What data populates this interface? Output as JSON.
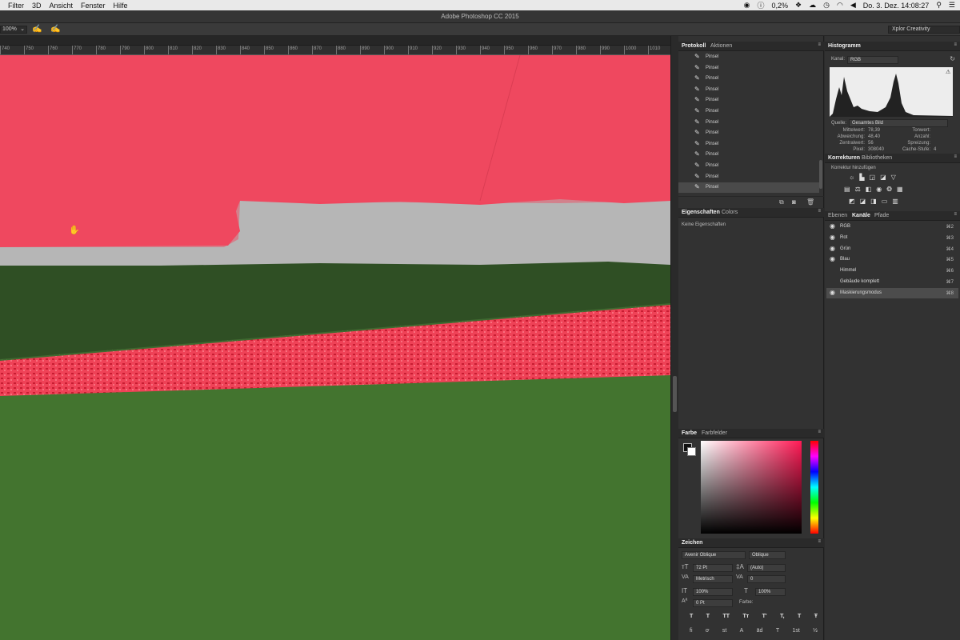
{
  "menubar": {
    "items": [
      "Filter",
      "3D",
      "Ansicht",
      "Fenster",
      "Hilfe"
    ],
    "battery": "0,2%",
    "datetime": "Do. 3. Dez.  14:08:27"
  },
  "window": {
    "title": "Adobe Photoshop CC 2015"
  },
  "options": {
    "zoom": "100%",
    "workspace": "Xplor Creativity"
  },
  "ruler": {
    "ticks": [
      "740",
      "750",
      "760",
      "770",
      "780",
      "790",
      "800",
      "810",
      "820",
      "830",
      "840",
      "850",
      "860",
      "870",
      "880",
      "890",
      "900",
      "910",
      "920",
      "930",
      "940",
      "950",
      "960",
      "970",
      "980",
      "990",
      "1000",
      "1010"
    ]
  },
  "history": {
    "tabs": [
      "Protokoll",
      "Aktionen"
    ],
    "items": [
      "Pinsel",
      "Pinsel",
      "Pinsel",
      "Pinsel",
      "Pinsel",
      "Pinsel",
      "Pinsel",
      "Pinsel",
      "Pinsel",
      "Pinsel",
      "Pinsel",
      "Pinsel",
      "Pinsel"
    ]
  },
  "properties": {
    "tabs": [
      "Eigenschaften",
      "Colors"
    ],
    "empty": "Keine Eigenschaften"
  },
  "color": {
    "tabs": [
      "Farbe",
      "Farbfelder"
    ],
    "hue_color": "#ff1a55"
  },
  "histogram": {
    "title": "Histogramm",
    "channel_label": "Kanal:",
    "channel_value": "RGB",
    "source_label": "Quelle:",
    "source_value": "Gesamtes Bild",
    "stats_left": [
      {
        "label": "Mittelwert:",
        "value": "78,39"
      },
      {
        "label": "Abweichung:",
        "value": "48,40"
      },
      {
        "label": "Zentralwert:",
        "value": "56"
      },
      {
        "label": "Pixel:",
        "value": "308040"
      }
    ],
    "stats_right": [
      {
        "label": "Tonwert:",
        "value": ""
      },
      {
        "label": "Anzahl:",
        "value": ""
      },
      {
        "label": "Spreizung:",
        "value": ""
      },
      {
        "label": "Cache-Stufe:",
        "value": "4"
      }
    ]
  },
  "corrections": {
    "tabs": [
      "Korrekturen",
      "Bibliotheken"
    ],
    "add_label": "Korrektur hinzufügen"
  },
  "channels": {
    "tabs": [
      "Ebenen",
      "Kanäle",
      "Pfade"
    ],
    "items": [
      {
        "name": "RGB",
        "shortcut": "⌘2",
        "visible": true
      },
      {
        "name": "Rot",
        "shortcut": "⌘3",
        "visible": true
      },
      {
        "name": "Grün",
        "shortcut": "⌘4",
        "visible": true
      },
      {
        "name": "Blau",
        "shortcut": "⌘5",
        "visible": true
      },
      {
        "name": "Himmel",
        "shortcut": "⌘6",
        "visible": false
      },
      {
        "name": "Gebäude komplett",
        "shortcut": "⌘7",
        "visible": false
      },
      {
        "name": "Maskierungsmodus",
        "shortcut": "⌘8",
        "visible": true
      }
    ]
  },
  "character": {
    "title": "Zeichen",
    "font_family": "Avenir Oblique",
    "font_style": "Oblique",
    "size": "72 Pt",
    "leading": "(Auto)",
    "kerning": "Metrisch",
    "tracking": "0",
    "vscale": "100%",
    "hscale": "100%",
    "baseline": "0 Pt",
    "color_label": "Farbe:",
    "style_buttons": [
      "T",
      "T",
      "TT",
      "Tт",
      "T'",
      "T,",
      "T",
      "Ŧ"
    ],
    "ot_buttons": [
      "fi",
      "ơ",
      "st",
      "A",
      "ād",
      "T",
      "1st",
      "½"
    ]
  }
}
